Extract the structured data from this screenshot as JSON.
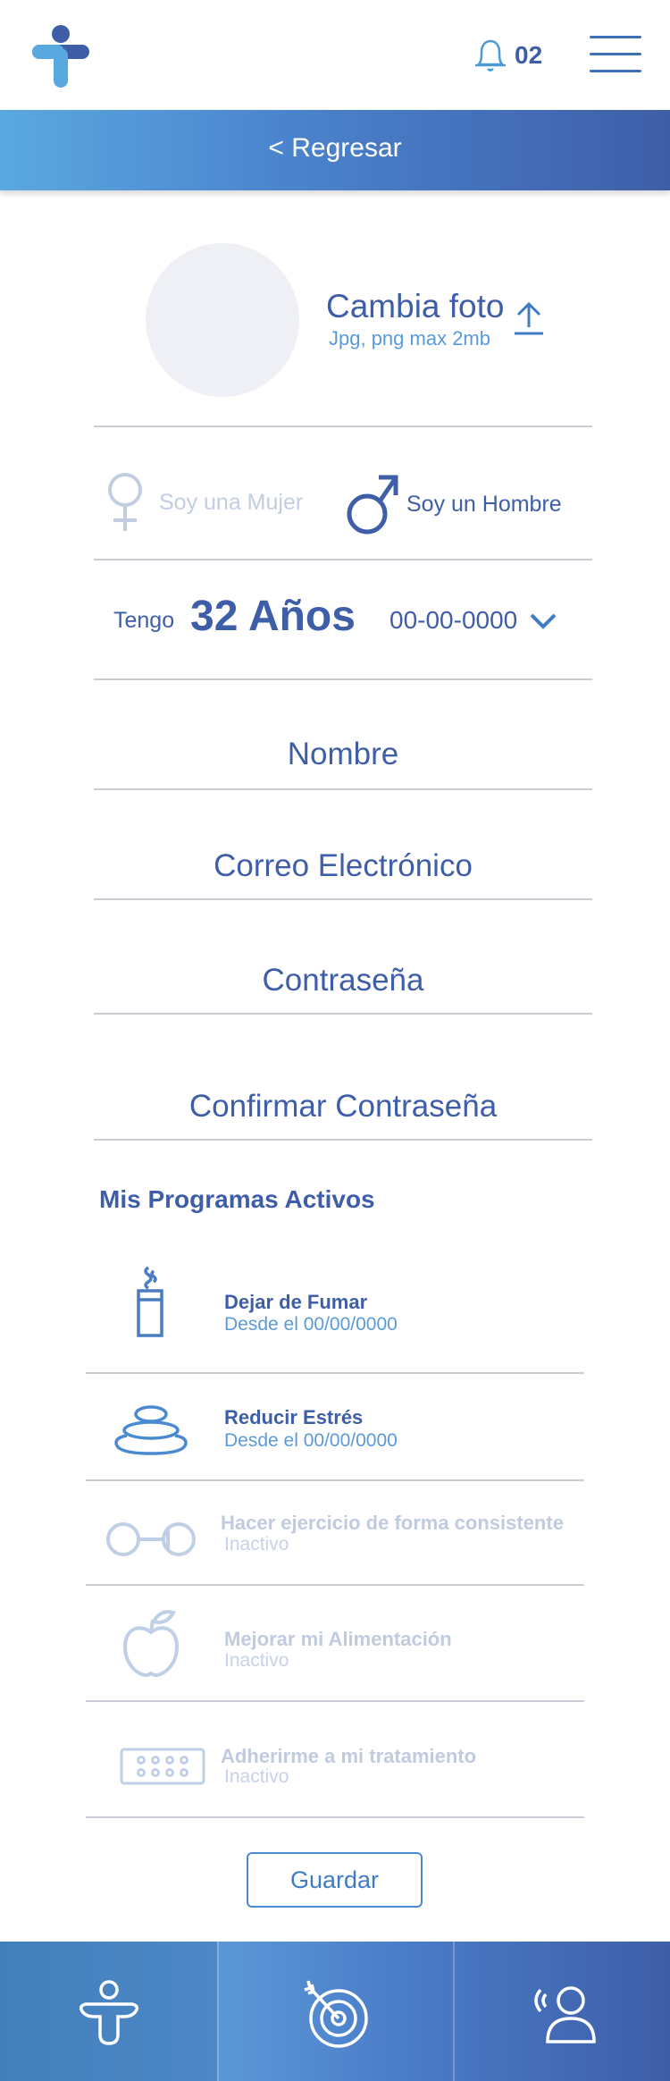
{
  "header": {
    "logo_icon": "brand-logo",
    "bell_icon": "bell-icon",
    "notification_count": "02",
    "menu_icon": "hamburger-menu-icon"
  },
  "backbar": {
    "label": "< Regresar"
  },
  "photo": {
    "title": "Cambia foto",
    "subtitle": "Jpg, png max 2mb",
    "upload_icon": "upload-icon"
  },
  "gender": {
    "female_label": "Soy una Mujer",
    "male_label": "Soy un Hombre",
    "selected": "male"
  },
  "age": {
    "prefix": "Tengo",
    "value": "32 Años",
    "date": "00-00-0000"
  },
  "fields": {
    "name": "Nombre",
    "email": "Correo Electrónico",
    "password": "Contraseña",
    "confirm_password": "Confirmar Contraseña"
  },
  "programs": {
    "title": "Mis Programas Activos",
    "items": [
      {
        "title": "Dejar de Fumar",
        "status": "Desde el 00/00/0000",
        "active": true,
        "icon": "cigarette-icon"
      },
      {
        "title": "Reducir Estrés",
        "status": "Desde el 00/00/0000",
        "active": true,
        "icon": "stones-icon"
      },
      {
        "title": "Hacer ejercicio de forma consistente",
        "status": "Inactivo",
        "active": false,
        "icon": "dumbbell-icon"
      },
      {
        "title": "Mejorar mi Alimentación",
        "status": "Inactivo",
        "active": false,
        "icon": "apple-icon"
      },
      {
        "title": "Adherirme a mi tratamiento",
        "status": "Inactivo",
        "active": false,
        "icon": "pills-icon"
      }
    ]
  },
  "save_label": "Guardar",
  "bottom_nav": {
    "items": [
      "health-icon",
      "target-icon",
      "support-icon"
    ]
  },
  "colors": {
    "primary": "#3f5ea8",
    "accent": "#5a9ad8",
    "inactive": "#c0cbe0"
  }
}
